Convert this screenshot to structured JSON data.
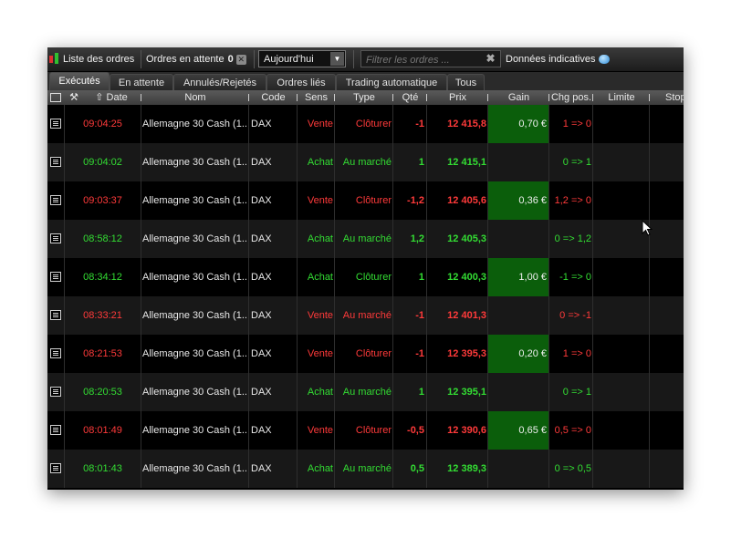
{
  "toolbar": {
    "orders_list_label": "Liste des ordres",
    "pending_label": "Ordres en attente",
    "pending_count": "0",
    "period_value": "Aujourd'hui",
    "filter_placeholder": "Filtrer les ordres ...",
    "indicative_label": "Données indicatives"
  },
  "tabs": [
    "Exécutés",
    "En attente",
    "Annulés/Rejetés",
    "Ordres liés",
    "Trading automatique",
    "Tous"
  ],
  "active_tab": "Exécutés",
  "columns": {
    "date": "Date",
    "nom": "Nom",
    "code": "Code",
    "sens": "Sens",
    "type": "Type",
    "qte": "Qté",
    "prix": "Prix",
    "gain": "Gain",
    "chg": "Chg pos.",
    "limite": "Limite",
    "stop": "Stop"
  },
  "rows": [
    {
      "date": "09:04:25",
      "nom": "Allemagne 30 Cash (1...",
      "code": "DAX",
      "sens": "Vente",
      "type": "Clôturer",
      "qte": "-1",
      "prix": "12 415,8",
      "gain": "0,70 €",
      "chg": "1 => 0"
    },
    {
      "date": "09:04:02",
      "nom": "Allemagne 30 Cash (1...",
      "code": "DAX",
      "sens": "Achat",
      "type": "Au marché",
      "qte": "1",
      "prix": "12 415,1",
      "gain": "",
      "chg": "0 => 1"
    },
    {
      "date": "09:03:37",
      "nom": "Allemagne 30 Cash (1...",
      "code": "DAX",
      "sens": "Vente",
      "type": "Clôturer",
      "qte": "-1,2",
      "prix": "12 405,6",
      "gain": "0,36 €",
      "chg": "1,2 => 0"
    },
    {
      "date": "08:58:12",
      "nom": "Allemagne 30 Cash (1...",
      "code": "DAX",
      "sens": "Achat",
      "type": "Au marché",
      "qte": "1,2",
      "prix": "12 405,3",
      "gain": "",
      "chg": "0 => 1,2"
    },
    {
      "date": "08:34:12",
      "nom": "Allemagne 30 Cash (1...",
      "code": "DAX",
      "sens": "Achat",
      "type": "Clôturer",
      "qte": "1",
      "prix": "12 400,3",
      "gain": "1,00 €",
      "chg": "-1 => 0"
    },
    {
      "date": "08:33:21",
      "nom": "Allemagne 30 Cash (1...",
      "code": "DAX",
      "sens": "Vente",
      "type": "Au marché",
      "qte": "-1",
      "prix": "12 401,3",
      "gain": "",
      "chg": "0 => -1"
    },
    {
      "date": "08:21:53",
      "nom": "Allemagne 30 Cash (1...",
      "code": "DAX",
      "sens": "Vente",
      "type": "Clôturer",
      "qte": "-1",
      "prix": "12 395,3",
      "gain": "0,20 €",
      "chg": "1 => 0"
    },
    {
      "date": "08:20:53",
      "nom": "Allemagne 30 Cash (1...",
      "code": "DAX",
      "sens": "Achat",
      "type": "Au marché",
      "qte": "1",
      "prix": "12 395,1",
      "gain": "",
      "chg": "0 => 1"
    },
    {
      "date": "08:01:49",
      "nom": "Allemagne 30 Cash (1...",
      "code": "DAX",
      "sens": "Vente",
      "type": "Clôturer",
      "qte": "-0,5",
      "prix": "12 390,6",
      "gain": "0,65 €",
      "chg": "0,5 => 0"
    },
    {
      "date": "08:01:43",
      "nom": "Allemagne 30 Cash (1...",
      "code": "DAX",
      "sens": "Achat",
      "type": "Au marché",
      "qte": "0,5",
      "prix": "12 389,3",
      "gain": "",
      "chg": "0 => 0,5"
    }
  ],
  "colors": {
    "sell": "#ff3a3a",
    "buy": "#33dd33",
    "gain_bg": "#0b5e0b"
  }
}
